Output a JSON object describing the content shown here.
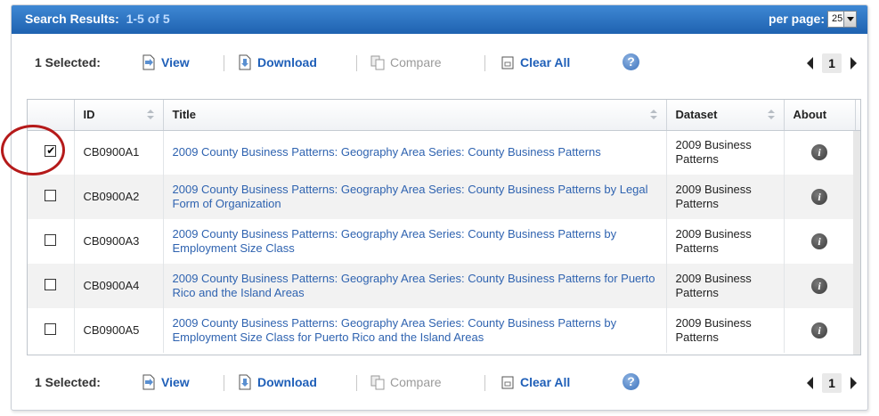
{
  "header": {
    "title_prefix": "Search Results:",
    "count_text": "1-5  of  5",
    "per_page_label": "per page:",
    "per_page_value": "25"
  },
  "toolbar": {
    "selected_text": "1 Selected:",
    "view": "View",
    "download": "Download",
    "compare": "Compare",
    "clear_all": "Clear All",
    "help": "?",
    "page": "1"
  },
  "table": {
    "columns": {
      "id": "ID",
      "title": "Title",
      "dataset": "Dataset",
      "about": "About"
    },
    "rows": [
      {
        "id": "CB0900A1",
        "title": "2009 County Business Patterns: Geography Area Series: County Business Patterns",
        "dataset": "2009 Business Patterns",
        "checked": true
      },
      {
        "id": "CB0900A2",
        "title": "2009 County Business Patterns: Geography Area Series: County Business Patterns by Legal Form of Organization",
        "dataset": "2009 Business Patterns",
        "checked": false
      },
      {
        "id": "CB0900A3",
        "title": "2009 County Business Patterns: Geography Area Series: County Business Patterns by Employment Size Class",
        "dataset": "2009 Business Patterns",
        "checked": false
      },
      {
        "id": "CB0900A4",
        "title": "2009 County Business Patterns: Geography Area Series: County Business Patterns for Puerto Rico and the Island Areas",
        "dataset": "2009 Business Patterns",
        "checked": false
      },
      {
        "id": "CB0900A5",
        "title": "2009 County Business Patterns: Geography Area Series: County Business Patterns by Employment Size Class for Puerto Rico and the Island Areas",
        "dataset": "2009 Business Patterns",
        "checked": false
      }
    ]
  },
  "colors": {
    "header_bg": "#2a6fc0",
    "link": "#2f63b0",
    "annotation": "#b51a1a"
  }
}
